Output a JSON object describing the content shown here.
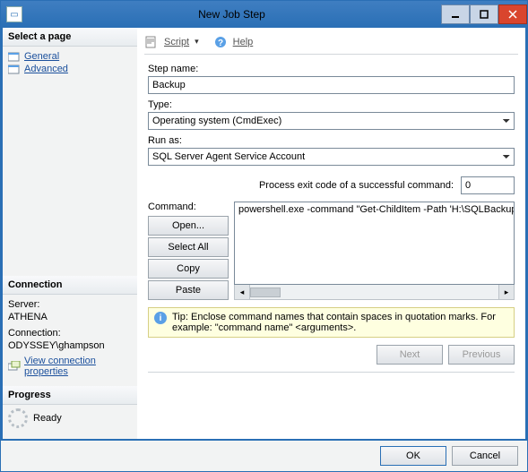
{
  "window": {
    "title": "New Job Step"
  },
  "titlebar_buttons": {
    "min": "min",
    "max": "max",
    "close": "close"
  },
  "toolbar": {
    "script": "Script",
    "help": "Help"
  },
  "left": {
    "select_page": "Select a page",
    "pages": {
      "general": "General",
      "advanced": "Advanced"
    },
    "connection_head": "Connection",
    "server_label": "Server:",
    "server_value": "ATHENA",
    "conn_label": "Connection:",
    "conn_value": "ODYSSEY\\ghampson",
    "view_conn": "View connection properties",
    "progress_head": "Progress",
    "progress_state": "Ready"
  },
  "form": {
    "step_name_label": "Step name:",
    "step_name_value": "Backup",
    "type_label": "Type:",
    "type_value": "Operating system (CmdExec)",
    "runas_label": "Run as:",
    "runas_value": "SQL Server Agent Service Account",
    "exit_code_label": "Process exit code of a successful command:",
    "exit_code_value": "0",
    "command_label": "Command:",
    "command_value": "powershell.exe -command \"Get-ChildItem -Path 'H:\\SQLBackup\\CDLat",
    "open_btn": "Open...",
    "selectall_btn": "Select All",
    "copy_btn": "Copy",
    "paste_btn": "Paste"
  },
  "tip": {
    "text": "Tip: Enclose command names that contain spaces in quotation marks. For example: \"command name\" <arguments>."
  },
  "nav": {
    "next": "Next",
    "prev": "Previous"
  },
  "footer": {
    "ok": "OK",
    "cancel": "Cancel"
  }
}
